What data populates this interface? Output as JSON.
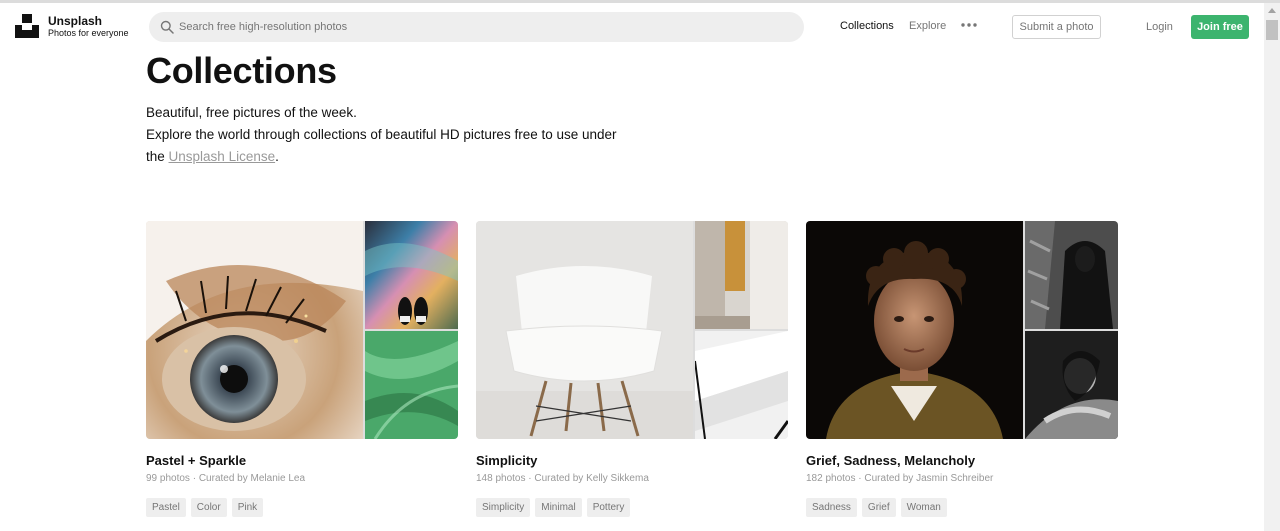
{
  "brand": {
    "name": "Unsplash",
    "tagline": "Photos for everyone"
  },
  "search": {
    "placeholder": "Search free high-resolution photos",
    "value": ""
  },
  "nav": {
    "collections": "Collections",
    "explore": "Explore",
    "submit": "Submit a photo",
    "login": "Login",
    "join": "Join free"
  },
  "page": {
    "title": "Collections",
    "line1": "Beautiful, free pictures of the week.",
    "line2": "Explore the world through collections of beautiful HD pictures free to use under",
    "line3_prefix": "the ",
    "license_link": "Unsplash License",
    "line3_suffix": "."
  },
  "collections": [
    {
      "title": "Pastel + Sparkle",
      "photos": "99 photos",
      "curator": "Curated by Melanie Lea",
      "tags": [
        "Pastel",
        "Color",
        "Pink"
      ]
    },
    {
      "title": "Simplicity",
      "photos": "148 photos",
      "curator": "Curated by Kelly Sikkema",
      "tags": [
        "Simplicity",
        "Minimal",
        "Pottery"
      ]
    },
    {
      "title": "Grief, Sadness, Melancholy",
      "photos": "182 photos",
      "curator": "Curated by Jasmin Schreiber",
      "tags": [
        "Sadness",
        "Grief",
        "Woman"
      ]
    }
  ],
  "colors": {
    "accent": "#3cb46e",
    "muted": "#767676",
    "tag_bg": "#eeeeee"
  }
}
